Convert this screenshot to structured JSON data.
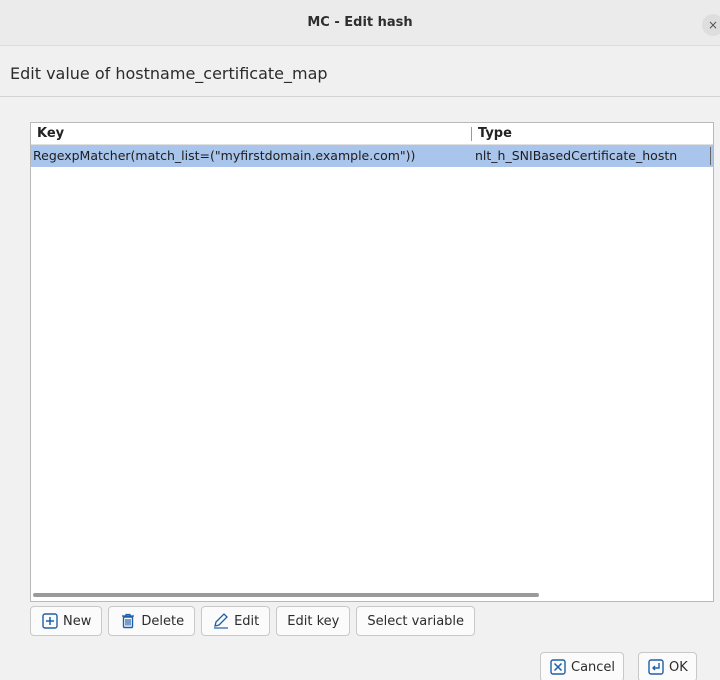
{
  "window": {
    "title": "MC - Edit hash",
    "close_glyph": "×"
  },
  "header": {
    "text": "Edit value of hostname_certificate_map"
  },
  "table": {
    "columns": [
      "Key",
      "Type"
    ],
    "rows": [
      {
        "key": "RegexpMatcher(match_list=(\"myfirstdomain.example.com\"))",
        "type": "nlt_h_SNIBasedCertificate_hostn",
        "selected": true
      }
    ]
  },
  "buttons": {
    "new": "New",
    "delete": "Delete",
    "edit": "Edit",
    "edit_key": "Edit key",
    "select_variable": "Select variable"
  },
  "dialog": {
    "cancel": "Cancel",
    "ok": "OK"
  },
  "icons": {
    "new": "plus-box-icon",
    "delete": "trash-icon",
    "edit": "pencil-icon",
    "cancel": "x-box-icon",
    "ok": "enter-icon"
  },
  "colors": {
    "selection": "#a9c5eb",
    "icon_blue": "#1f5fa8"
  }
}
